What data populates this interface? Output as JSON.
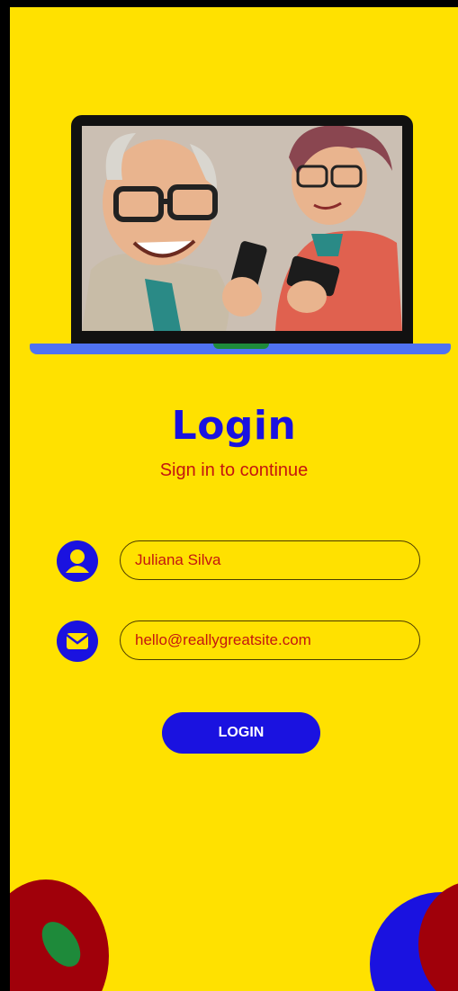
{
  "login": {
    "title": "Login",
    "subtitle": "Sign in to continue",
    "name_value": "Juliana Silva",
    "email_value": "hello@reallygreatsite.com",
    "button_label": "LOGIN"
  },
  "icons": {
    "name_field": "user-icon",
    "email_field": "mail-icon",
    "illustration": "laptop-elderly-couple-illustration"
  },
  "colors": {
    "background": "#FFE100",
    "primary_blue": "#1A12E0",
    "accent_red": "#C4160F",
    "laptop_base": "#4F72F2",
    "deco_dark_red": "#A0000A",
    "deco_green": "#1E8A3A"
  }
}
